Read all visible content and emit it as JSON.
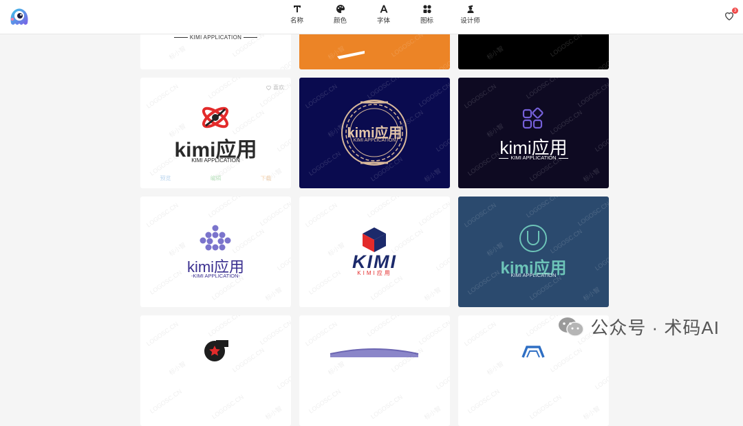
{
  "nav": {
    "items": [
      {
        "label": "名称",
        "icon": "text-t-icon"
      },
      {
        "label": "颜色",
        "icon": "palette-icon"
      },
      {
        "label": "字体",
        "icon": "font-a-icon"
      },
      {
        "label": "图标",
        "icon": "shapes-icon"
      },
      {
        "label": "设计师",
        "icon": "designer-icon"
      }
    ]
  },
  "favorites": {
    "count": "3"
  },
  "cards": {
    "c0": {
      "sub": "KIMI APPLICATION"
    },
    "c3": {
      "main": "kimi应用",
      "sub": "KIMI APPLICATION",
      "like": "喜欢",
      "actions": [
        "预览",
        "编辑",
        "下载"
      ]
    },
    "c4": {
      "main": "kimi应用",
      "sub": "KIMI APPLICATION"
    },
    "c5": {
      "main": "kimi应用",
      "sub": "KIMI APPLICATION"
    },
    "c6": {
      "main": "kimi应用",
      "sub": "-KIMI APPLICATION-"
    },
    "c7": {
      "main": "KIMI",
      "sub": "KIMI应用"
    },
    "c8": {
      "main": "kimi应用",
      "sub": "KIMI APPLICATION"
    }
  },
  "watermark": {
    "site": "LOGOSC.CN",
    "brand": "标小智"
  },
  "wechat": {
    "text": "公众号 · 术码AI"
  },
  "colors": {
    "accent_orange": "#ec8426",
    "navy": "#0a0b4f",
    "dark_purple": "#0e0a22",
    "slate_blue": "#2b4a6e",
    "teal": "#6dc4b8",
    "red": "#e32b2b"
  }
}
